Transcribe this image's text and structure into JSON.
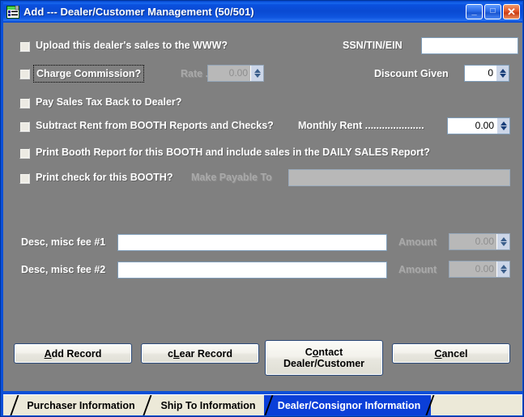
{
  "window": {
    "title": "Add --- Dealer/Customer Management (50/501)",
    "icon": "form-list-icon",
    "minimize_label": "_",
    "maximize_label": "□",
    "close_label": "✕",
    "accent_color": "#0b50d8",
    "client_bg": "#808080"
  },
  "form": {
    "checkboxes": [
      {
        "id": "upload-www",
        "label": "Upload this dealer's sales to the WWW?",
        "checked": false
      },
      {
        "id": "charge-commission",
        "label": "Charge Commission?",
        "checked": false,
        "focused": true
      },
      {
        "id": "pay-sales-tax",
        "label": "Pay Sales Tax Back to Dealer?",
        "checked": false
      },
      {
        "id": "subtract-rent",
        "label": "Subtract Rent from BOOTH Reports and Checks?",
        "checked": false
      },
      {
        "id": "print-booth-report",
        "label": "Print Booth Report for this BOOTH and include sales in the DAILY SALES Report?",
        "checked": false
      },
      {
        "id": "print-check",
        "label": "Print check for this BOOTH?",
        "checked": false
      }
    ],
    "fields": {
      "rate": {
        "label": "Rate ......",
        "value": "0.00",
        "enabled": false
      },
      "ssn": {
        "label": "SSN/TIN/EIN",
        "value": "",
        "enabled": true
      },
      "discount_given": {
        "label": "Discount Given",
        "value": "0",
        "enabled": true
      },
      "monthly_rent": {
        "label": "Monthly Rent .....................",
        "value": "0.00",
        "enabled": true
      },
      "make_payable_to": {
        "label": "Make Payable To",
        "value": "",
        "enabled": false
      },
      "misc_fee_1": {
        "label": "Desc, misc fee #1",
        "value": "",
        "enabled": true
      },
      "misc_fee_1_amount": {
        "label": "Amount",
        "value": "0.00",
        "enabled": false
      },
      "misc_fee_2": {
        "label": "Desc, misc fee #2",
        "value": "",
        "enabled": true
      },
      "misc_fee_2_amount": {
        "label": "Amount",
        "value": "0.00",
        "enabled": false
      }
    }
  },
  "buttons": {
    "add_record": {
      "pre": "",
      "accel": "A",
      "post": "dd Record"
    },
    "clear_record": {
      "pre": "c",
      "accel": "L",
      "post": "ear Record"
    },
    "contact": {
      "line1_pre": "C",
      "line1_accel": "o",
      "line1_post": "ntact",
      "line2": "Dealer/Customer"
    },
    "cancel": {
      "pre": "",
      "accel": "C",
      "post": "ancel"
    }
  },
  "tabs": [
    {
      "label": "Purchaser Information",
      "active": false
    },
    {
      "label": "Ship To Information",
      "active": false
    },
    {
      "label": "Dealer/Consignor Information",
      "active": true
    }
  ]
}
